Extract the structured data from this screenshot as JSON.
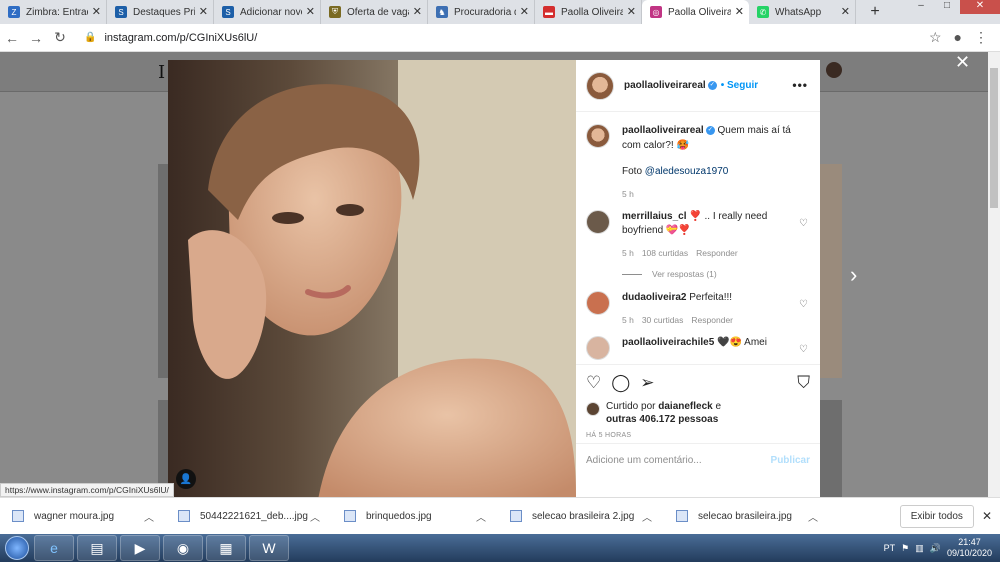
{
  "browser": {
    "tabs": [
      {
        "title": "Zimbra: Entrada",
        "color": "#2f6dc4"
      },
      {
        "title": "Destaques Prin",
        "color": "#1d5fa8"
      },
      {
        "title": "Adicionar novo",
        "color": "#1d5fa8"
      },
      {
        "title": "Oferta de vaga",
        "color": "#7a6a22"
      },
      {
        "title": "Procuradoria d",
        "color": "#3d6fb3"
      },
      {
        "title": "Paolla Oliveira",
        "color": "#d42e2e"
      },
      {
        "title": "Paolla Oliveira",
        "color": "#c13584",
        "active": true
      },
      {
        "title": "WhatsApp",
        "color": "#25d366"
      }
    ],
    "new_tab": "+",
    "url": "instagram.com/p/CGIniXUs6lU/",
    "status_url": "https://www.instagram.com/p/CGIniXUs6lU/"
  },
  "post": {
    "username": "paollaoliveirareal",
    "follow_label": "Seguir",
    "more_label": "•••",
    "caption": "Quem mais aí tá com calor?! 🥵",
    "photo_credit_prefix": "Foto",
    "photo_credit_handle": "@aledesouza1970",
    "caption_time": "5 h",
    "comments": [
      {
        "user": "merrillaius_cl",
        "text": "❣️ .. I really need boyfriend 💝❣️",
        "time": "5 h",
        "likes": "108 curtidas",
        "reply": "Responder",
        "view_replies": "Ver respostas (1)"
      },
      {
        "user": "dudaoliveira2",
        "text": "Perfeita!!!",
        "time": "5 h",
        "likes": "30 curtidas",
        "reply": "Responder"
      },
      {
        "user": "paollaoliveirachile5",
        "text": "🖤😍 Amei"
      }
    ],
    "liked_by_prefix": "Curtido por",
    "liked_by_user": "daianefleck",
    "liked_by_suffix": "e",
    "liked_by_others": "outras 406.172 pessoas",
    "time_ago": "HÁ 5 HORAS",
    "add_comment_placeholder": "Adicione um comentário...",
    "publish_label": "Publicar"
  },
  "downloads": {
    "items": [
      "wagner moura.jpg",
      "50442221621_deb....jpg",
      "brinquedos.jpg",
      "selecao brasileira 2.jpg",
      "selecao brasileira.jpg"
    ],
    "show_all": "Exibir todos"
  },
  "taskbar": {
    "lang": "PT",
    "time": "21:47",
    "date": "09/10/2020"
  }
}
